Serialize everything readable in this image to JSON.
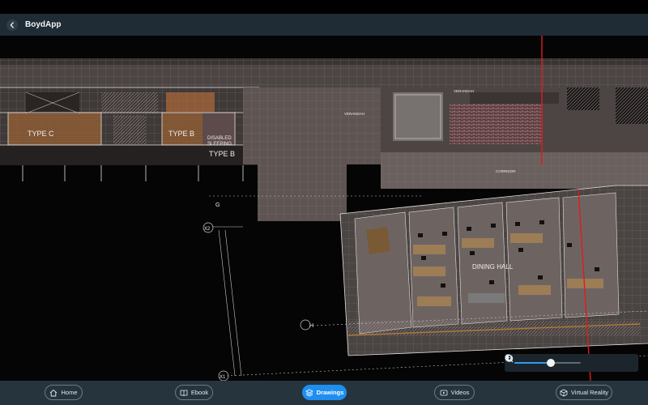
{
  "app": {
    "title": "BoydApp"
  },
  "drawing": {
    "labels": {
      "type_c": "TYPE C",
      "type_b_1": "TYPE B",
      "type_b_2": "TYPE B",
      "disabled": "DISABLED",
      "sleeping": "SLEEPING",
      "verandah": "VERANDAH",
      "verandah_2": "VERANDAH",
      "corridor": "CORRIDOR",
      "dining_hall": "DINING HALL",
      "grid_g": "G",
      "grid_x2": "X2",
      "grid_h": "H",
      "grid_x1": "X1"
    }
  },
  "viewer_tools": {
    "contrast_level": 0.56
  },
  "tabs": [
    {
      "label": "Home",
      "icon": "home-icon",
      "active": false
    },
    {
      "label": "Ebook",
      "icon": "book-icon",
      "active": false
    },
    {
      "label": "Drawings",
      "icon": "layers-icon",
      "active": true
    },
    {
      "label": "Videos",
      "icon": "video-icon",
      "active": false
    },
    {
      "label": "Virtual Reality",
      "icon": "cube-icon",
      "active": false
    }
  ],
  "colors": {
    "accent": "#1e8ef0",
    "header_bg": "#1f2c35",
    "tabbar_bg": "#26343e",
    "markup_red": "#e21b1b"
  }
}
